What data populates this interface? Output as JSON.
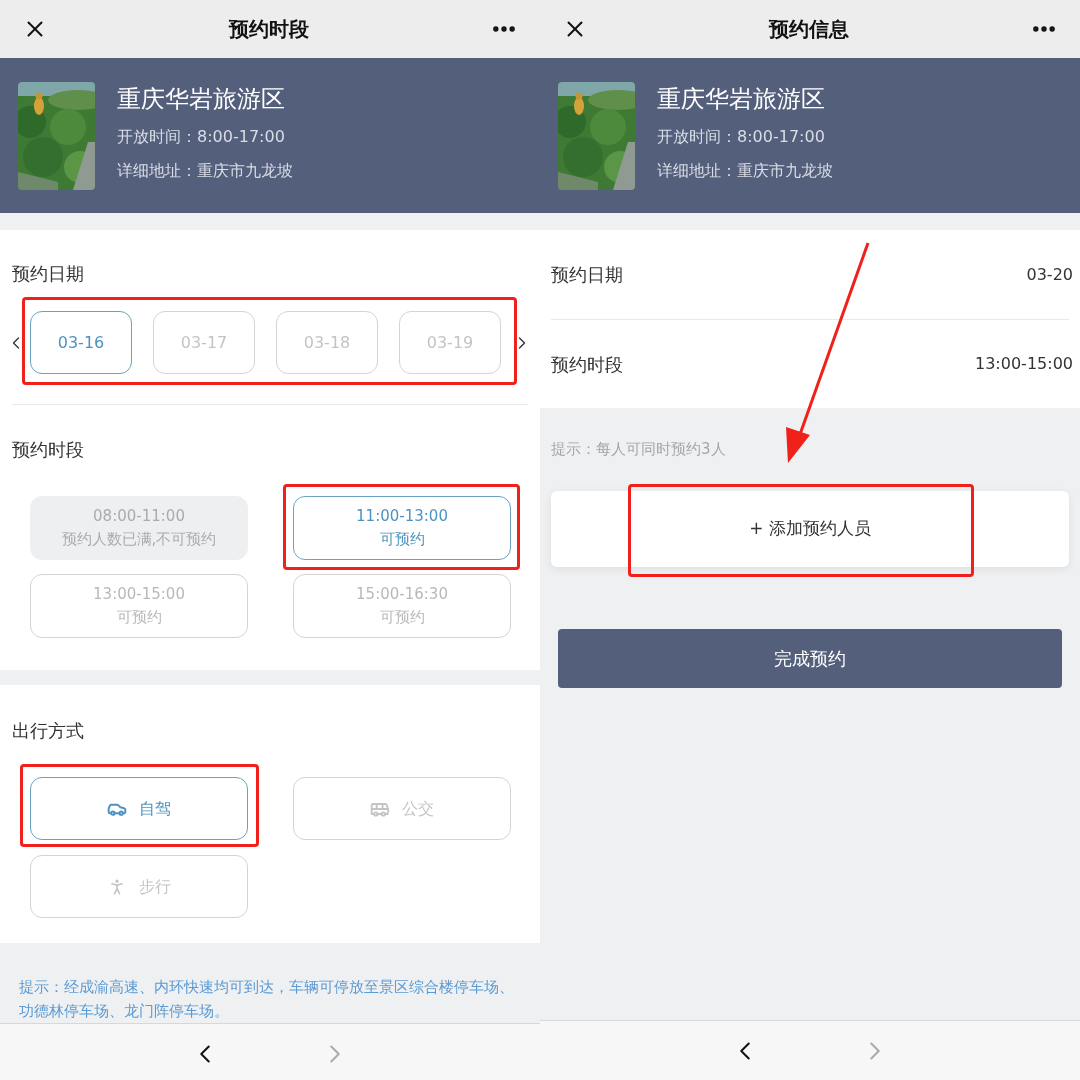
{
  "screens": [
    {
      "kind": "slot_picker",
      "title": "预约时段",
      "venue": {
        "name": "重庆华岩旅游区",
        "hours": "开放时间：8:00-17:00",
        "address": "详细地址：重庆市九龙坡"
      },
      "date_section": {
        "title": "预约日期",
        "highlighted": true,
        "dates": [
          {
            "label": "03-16",
            "selected": true
          },
          {
            "label": "03-17",
            "selected": false
          },
          {
            "label": "03-18",
            "selected": false
          },
          {
            "label": "03-19",
            "selected": false
          }
        ]
      },
      "slot_section": {
        "title": "预约时段",
        "slots": [
          {
            "time": "08:00-11:00",
            "status": "预约人数已满,不可预约",
            "disabled": true,
            "selected": false,
            "highlighted": false
          },
          {
            "time": "11:00-13:00",
            "status": "可预约",
            "disabled": false,
            "selected": true,
            "highlighted": true
          },
          {
            "time": "13:00-15:00",
            "status": "可预约",
            "disabled": false,
            "selected": false,
            "highlighted": false
          },
          {
            "time": "15:00-16:30",
            "status": "可预约",
            "disabled": false,
            "selected": false,
            "highlighted": false
          }
        ]
      },
      "travel_section": {
        "title": "出行方式",
        "modes": [
          {
            "kind": "car",
            "label": "自驾",
            "selected": true,
            "highlighted": true
          },
          {
            "kind": "bus",
            "label": "公交",
            "selected": false,
            "highlighted": false
          },
          {
            "kind": "walk",
            "label": "步行",
            "selected": false,
            "highlighted": false
          }
        ]
      },
      "hint": "提示：经成渝高速、内环快速均可到达，车辆可停放至景区综合楼停车场、功德林停车场、龙门阵停车场。",
      "nav": {
        "back_disabled": false,
        "forward_disabled": true
      }
    },
    {
      "kind": "summary",
      "title": "预约信息",
      "venue": {
        "name": "重庆华岩旅游区",
        "hours": "开放时间：8:00-17:00",
        "address": "详细地址：重庆市九龙坡"
      },
      "rows": [
        {
          "label": "预约日期",
          "value": "03-20"
        },
        {
          "label": "预约时段",
          "value": "13:00-15:00"
        }
      ],
      "hint": "提示：每人可同时预约3人",
      "add_button": {
        "label": "+ 添加预约人员",
        "highlighted": true
      },
      "submit_button": "完成预约",
      "nav": {
        "back_disabled": false,
        "forward_disabled": true
      }
    }
  ]
}
